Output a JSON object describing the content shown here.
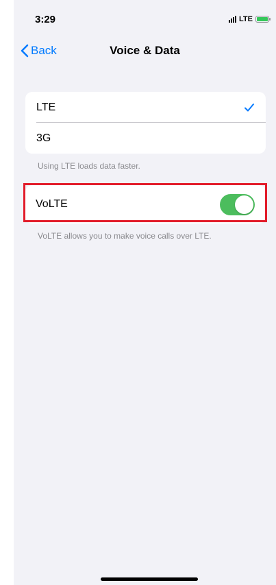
{
  "status_bar": {
    "time": "3:29",
    "carrier": "LTE"
  },
  "nav": {
    "back_label": "Back",
    "title": "Voice & Data"
  },
  "network_options": {
    "items": [
      {
        "label": "LTE",
        "selected": true
      },
      {
        "label": "3G",
        "selected": false
      }
    ],
    "footer": "Using LTE loads data faster."
  },
  "volte": {
    "label": "VoLTE",
    "enabled": true,
    "footer": "VoLTE allows you to make voice calls over LTE."
  },
  "colors": {
    "accent": "#007aff",
    "toggle_on": "#4cbd5d",
    "highlight": "#e21c2a",
    "background": "#f2f2f7"
  }
}
